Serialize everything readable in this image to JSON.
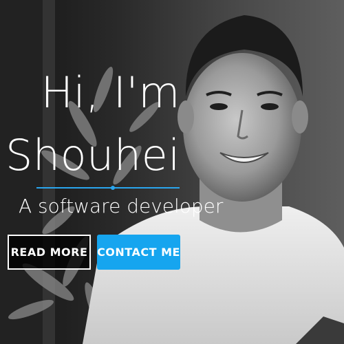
{
  "hero": {
    "greeting": "Hi, I'm",
    "name": "Shouhei",
    "tagline": "A software developer",
    "read_more_label": "READ MORE",
    "contact_label": "CONTACT ME"
  },
  "colors": {
    "accent": "#16a5ef",
    "text": "#ffffff",
    "read_more_bg": "#000000"
  },
  "icons": [
    "underline-dot-icon"
  ]
}
